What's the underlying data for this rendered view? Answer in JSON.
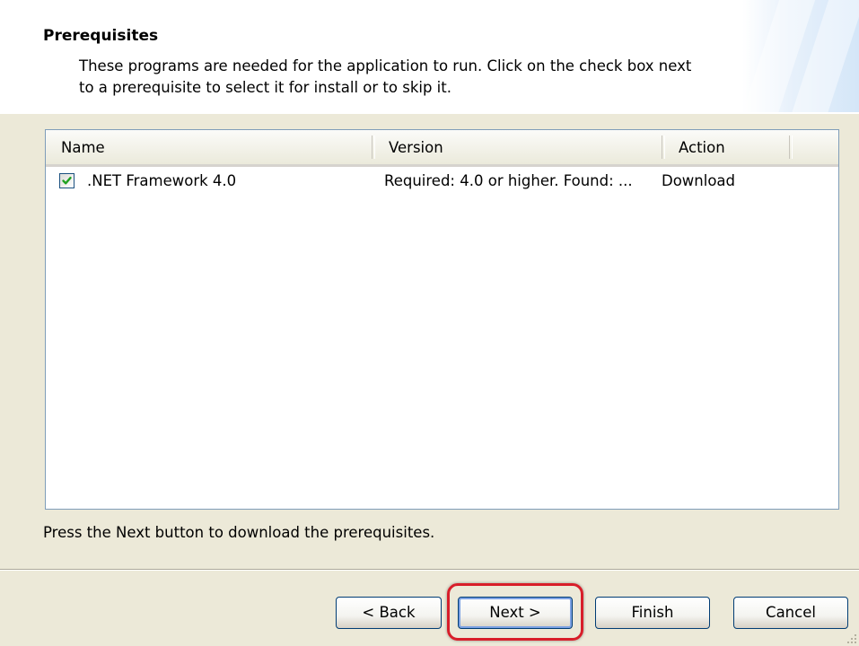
{
  "header": {
    "title": "Prerequisites",
    "description": "These programs are needed for the application to run. Click on the check box next to a prerequisite to select it for install or to skip it."
  },
  "table": {
    "columns": [
      "Name",
      "Version",
      "Action"
    ],
    "rows": [
      {
        "checked": true,
        "name": ".NET Framework 4.0",
        "version": "Required: 4.0 or higher. Found: ...",
        "action": "Download"
      }
    ]
  },
  "footer": {
    "instruction": "Press the Next button to download the prerequisites."
  },
  "buttons": {
    "back": "< Back",
    "next": "Next >",
    "finish": "Finish",
    "cancel": "Cancel"
  },
  "colors": {
    "dialog_background": "#ece9d8",
    "highlight": "#d81e2a",
    "checkmark": "#21a121"
  }
}
